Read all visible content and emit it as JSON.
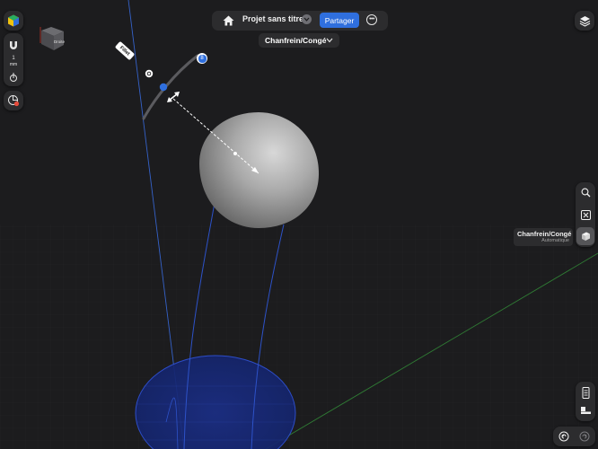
{
  "header": {
    "project_title": "Projet sans titre",
    "share_label": "Partager",
    "home_icon": "home-icon",
    "dropdown_icon": "chevron-down-icon",
    "more_icon": "ellipsis-icon"
  },
  "mode": {
    "label": "Chanfrein/Congé",
    "chevron_icon": "chevron-down-icon"
  },
  "left_toolbar": {
    "units_value": "1",
    "units_label": "mm"
  },
  "view_cube": {
    "face_label": "Droite"
  },
  "manipulator": {
    "tag_label": "Fillet",
    "badge_value": "8"
  },
  "tool_hint": {
    "name": "Chanfrein/Congé",
    "subtitle": "Automatique"
  },
  "colors": {
    "accent": "#2f6fde",
    "background": "#1c1c1e",
    "panel": "#2c2c2e",
    "sketch_circle": "#1f3a9e"
  }
}
